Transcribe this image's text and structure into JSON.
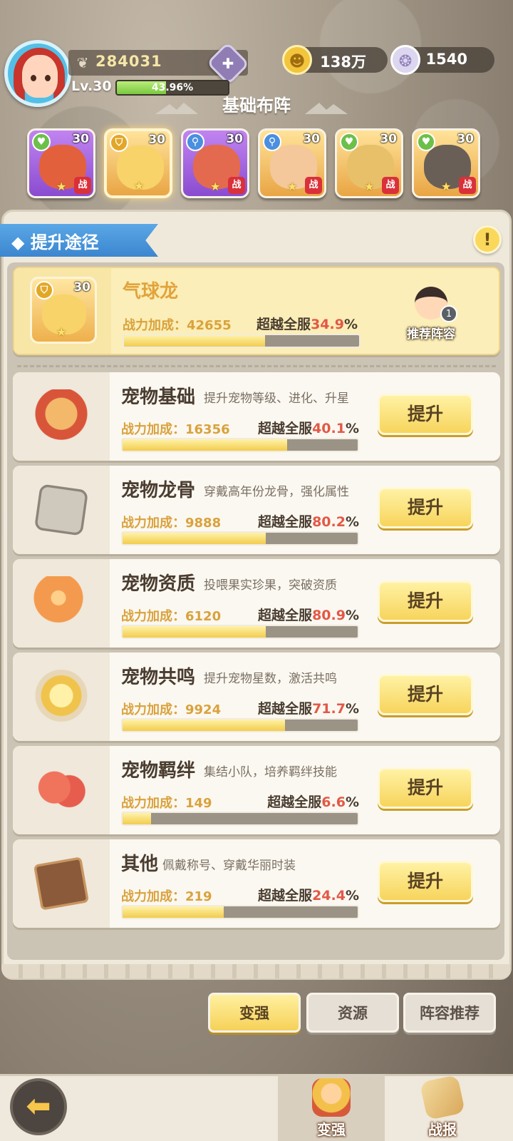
{
  "player": {
    "power": "284031",
    "level": "Lv.30",
    "exp_percent_text": "43.96%",
    "exp_fraction": 0.4396
  },
  "currency": {
    "gold": "138万",
    "shells": "1540"
  },
  "formation_title": "基础布阵",
  "pets": [
    {
      "level": "30",
      "badge": "战",
      "frame": "purple",
      "type_icon": "heart-icon"
    },
    {
      "level": "30",
      "badge": "",
      "frame": "gold",
      "type_icon": "shield-icon",
      "selected": true
    },
    {
      "level": "30",
      "badge": "战",
      "frame": "purple",
      "type_icon": "key-icon"
    },
    {
      "level": "30",
      "badge": "战",
      "frame": "gold",
      "type_icon": "key-icon"
    },
    {
      "level": "30",
      "badge": "战",
      "frame": "gold",
      "type_icon": "heart-icon"
    },
    {
      "level": "30",
      "badge": "战",
      "frame": "gold",
      "type_icon": "heart-icon"
    }
  ],
  "section_title": "提升途径",
  "featured": {
    "level": "30",
    "name": "气球龙",
    "bonus_label": "战力加成：42655",
    "beyond_label": "超越全服",
    "beyond_pct": "34.9",
    "pct_sign": "%",
    "fill": 0.6,
    "recommend_label": "推荐阵容",
    "recommend_badge": "1"
  },
  "rows": [
    {
      "title": "宠物基础",
      "subtitle": "提升宠物等级、进化、升星",
      "bonus": "战力加成：16356",
      "beyond_label": "超越全服",
      "pct": "40.1",
      "pct_sign": "%",
      "fill": 0.7,
      "button": "提升",
      "icon": "dragon-pet-icon"
    },
    {
      "title": "宠物龙骨",
      "subtitle": "穿戴高年份龙骨，强化属性",
      "bonus": "战力加成：9888",
      "beyond_label": "超越全服",
      "pct": "80.2",
      "pct_sign": "%",
      "fill": 0.61,
      "button": "提升",
      "icon": "dragon-bone-icon"
    },
    {
      "title": "宠物资质",
      "subtitle": "投喂果实珍果，突破资质",
      "bonus": "战力加成：6120",
      "beyond_label": "超越全服",
      "pct": "80.9",
      "pct_sign": "%",
      "fill": 0.61,
      "button": "提升",
      "icon": "egg-icon"
    },
    {
      "title": "宠物共鸣",
      "subtitle": "提升宠物星数，激活共鸣",
      "bonus": "战力加成：9924",
      "beyond_label": "超越全服",
      "pct": "71.7",
      "pct_sign": "%",
      "fill": 0.69,
      "button": "提升",
      "icon": "star-crest-icon"
    },
    {
      "title": "宠物羁绊",
      "subtitle": "集结小队，培养羁绊技能",
      "bonus": "战力加成：149",
      "beyond_label": "超越全服",
      "pct": "6.6",
      "pct_sign": "%",
      "fill": 0.12,
      "button": "提升",
      "icon": "hearts-icon"
    },
    {
      "title": "其他",
      "subtitle": "佩戴称号、穿戴华丽时装",
      "bonus": "战力加成：219",
      "beyond_label": "超越全服",
      "pct": "24.4",
      "pct_sign": "%",
      "fill": 0.43,
      "button": "提升",
      "icon": "book-icon"
    }
  ],
  "tabs": [
    {
      "label": "变强",
      "active": true
    },
    {
      "label": "资源",
      "active": false
    },
    {
      "label": "阵容推荐",
      "active": false
    }
  ],
  "nav": {
    "back_icon": "back-arrow-icon",
    "items": [
      {
        "label": "变强",
        "icon": "hero-icon",
        "active": true
      },
      {
        "label": "战报",
        "icon": "scroll-icon",
        "active": false
      }
    ]
  },
  "colors": {
    "accent_yellow": "#f6d158",
    "ribbon_blue": "#3b86cf",
    "pct_red": "#e35846",
    "bonus_gold": "#d9a23d"
  }
}
